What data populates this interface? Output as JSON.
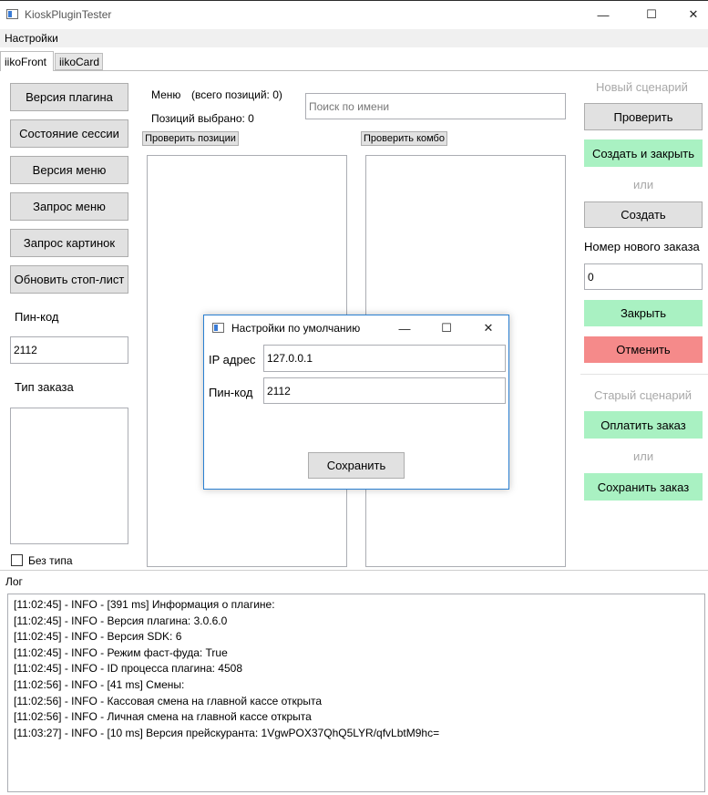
{
  "window": {
    "title": "KioskPluginTester",
    "minimize": "—",
    "maximize": "☐",
    "close": "✕"
  },
  "menu": {
    "settings": "Настройки"
  },
  "tabs": [
    {
      "label": "iikoFront",
      "active": true
    },
    {
      "label": "iikoCard",
      "active": false
    }
  ],
  "left_panel": {
    "buttons": [
      "Версия плагина",
      "Состояние сессии",
      "Версия меню",
      "Запрос меню",
      "Запрос картинок",
      "Обновить стоп-лист"
    ],
    "pin_label": "Пин-код",
    "pin_value": "2112",
    "order_type_label": "Тип заказа",
    "no_type_label": "Без типа"
  },
  "center_panel": {
    "menu_label": "Меню",
    "total_positions": "(всего позиций: 0)",
    "selected_positions": "Позиций выбрано: 0",
    "search_placeholder": "Поиск по имени",
    "check_positions": "Проверить позиции",
    "check_combo": "Проверить комбо"
  },
  "right_panel": {
    "new_scenario": "Новый сценарий",
    "check": "Проверить",
    "create_and_close": "Создать и закрыть",
    "or1": "или",
    "create": "Создать",
    "new_order_number_label": "Номер нового заказа",
    "new_order_number_value": "0",
    "close": "Закрыть",
    "cancel": "Отменить",
    "old_scenario": "Старый сценарий",
    "pay_order": "Оплатить заказ",
    "or2": "или",
    "save_order": "Сохранить заказ"
  },
  "log": {
    "label": "Лог",
    "lines": [
      "[11:02:45] - INFO - [391 ms] Информация о плагине:",
      "[11:02:45] - INFO -   Версия плагина: 3.0.6.0",
      "[11:02:45] - INFO -   Версия SDK: 6",
      "[11:02:45] - INFO -   Режим фаст-фуда: True",
      "[11:02:45] - INFO -   ID процесса плагина: 4508",
      "[11:02:56] - INFO - [41 ms] Смены:",
      "[11:02:56] - INFO -   Кассовая смена на главной кассе открыта",
      "[11:02:56] - INFO -   Личная смена на главной кассе открыта",
      "[11:03:27] - INFO - [10 ms] Версия прейскуранта: 1VgwPOX37QhQ5LYR/qfvLbtM9hc="
    ]
  },
  "dialog": {
    "title": "Настройки по умолчанию",
    "ip_label": "IP адрес",
    "ip_value": "127.0.0.1",
    "pin_label": "Пин-код",
    "pin_value": "2112",
    "save": "Сохранить",
    "minimize": "—",
    "maximize": "☐",
    "close": "✕"
  },
  "colors": {
    "green_button": "#a9f1c2",
    "red_button": "#f58a8a",
    "dialog_border": "#2a7fd1"
  }
}
